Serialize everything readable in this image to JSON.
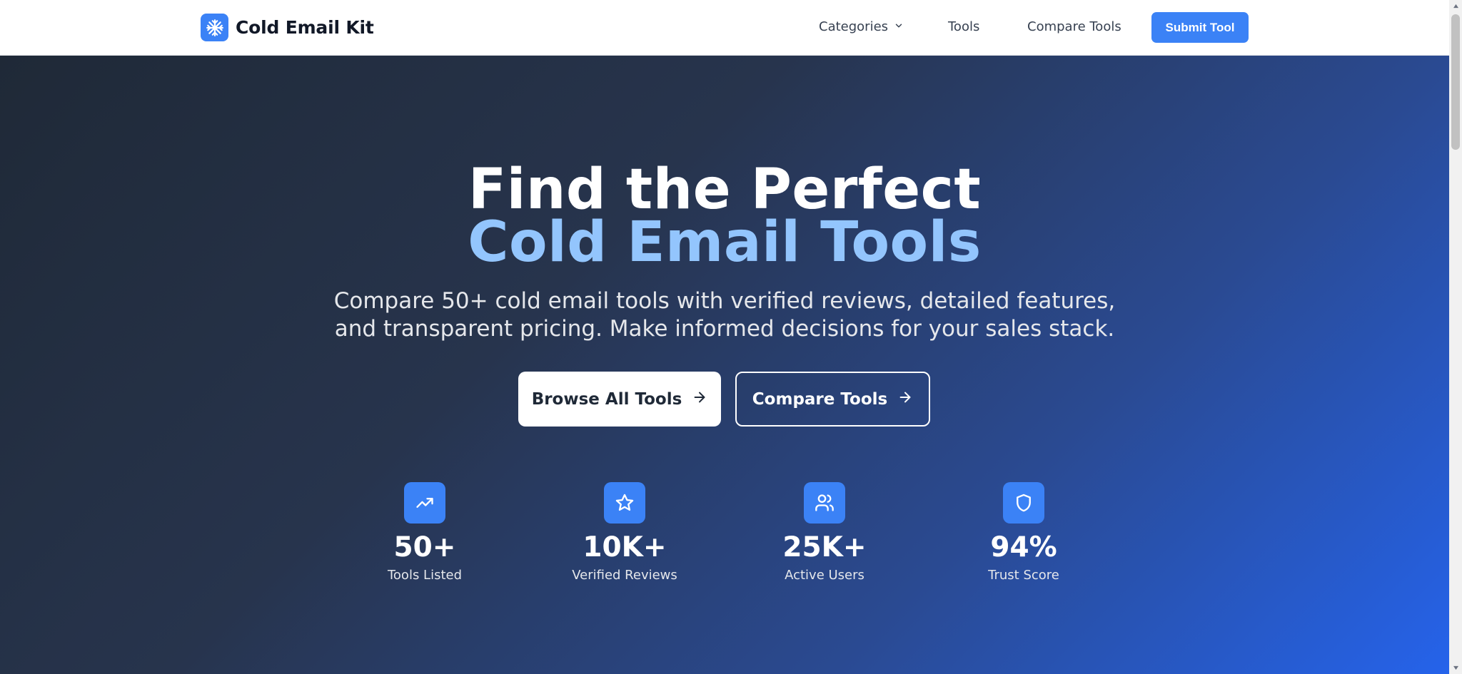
{
  "header": {
    "logo_text": "Cold Email Kit",
    "nav": {
      "categories_label": "Categories",
      "tools_label": "Tools",
      "compare_label": "Compare Tools"
    },
    "submit_label": "Submit Tool"
  },
  "hero": {
    "title_line1": "Find the Perfect",
    "title_line2": "Cold Email Tools",
    "subtitle": "Compare 50+ cold email tools with verified reviews, detailed features, and transparent pricing. Make informed decisions for your sales stack.",
    "primary_button_label": "Browse All Tools",
    "secondary_button_label": "Compare Tools"
  },
  "stats": [
    {
      "icon": "trending-up-icon",
      "value": "50+",
      "label": "Tools Listed"
    },
    {
      "icon": "star-icon",
      "value": "10K+",
      "label": "Verified Reviews"
    },
    {
      "icon": "users-icon",
      "value": "25K+",
      "label": "Active Users"
    },
    {
      "icon": "shield-icon",
      "value": "94%",
      "label": "Trust Score"
    }
  ],
  "colors": {
    "accent": "#3b82f6",
    "title_accent": "#93c5fd",
    "hero_gradient_start": "#1f2937",
    "hero_gradient_end": "#2563eb"
  }
}
